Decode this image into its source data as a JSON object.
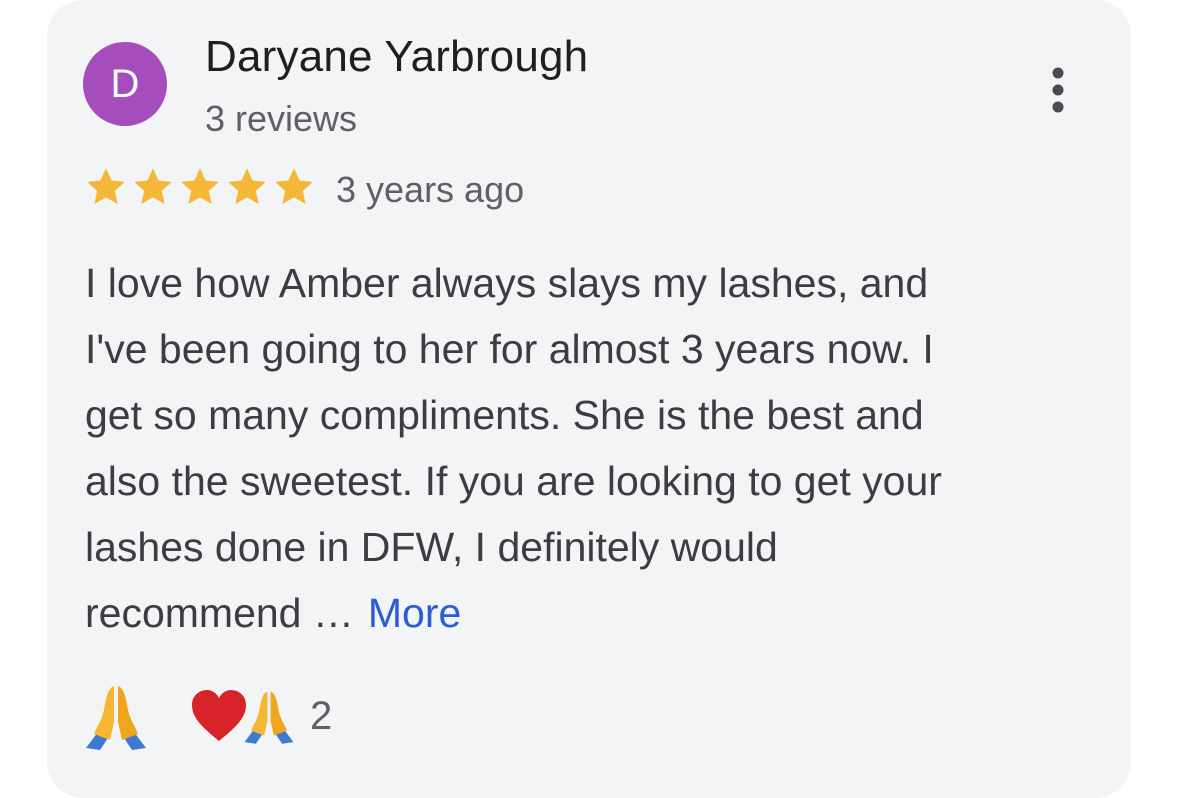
{
  "review": {
    "avatar_letter": "D",
    "avatar_color": "#a54dbd",
    "author_name": "Daryane Yarbrough",
    "author_reviews": "3 reviews",
    "rating": 5,
    "rating_max": 5,
    "star_color": "#f4b73a",
    "time_ago": "3 years ago",
    "text_lines": [
      "I love how Amber always slays my lashes, and",
      "I've been going to her for almost 3 years now. I",
      "get so many compliments. She is the best and",
      "also the sweetest. If you are looking to get your",
      "lashes done in DFW, I definitely would",
      "recommend …"
    ],
    "more_label": "More",
    "more_color": "#2c5bd6",
    "menu_icon": "more-vert-icon"
  },
  "reactions": {
    "thanks_icon": "folded-hands-icon",
    "heart_icon": "red-heart-icon",
    "count": "2"
  }
}
